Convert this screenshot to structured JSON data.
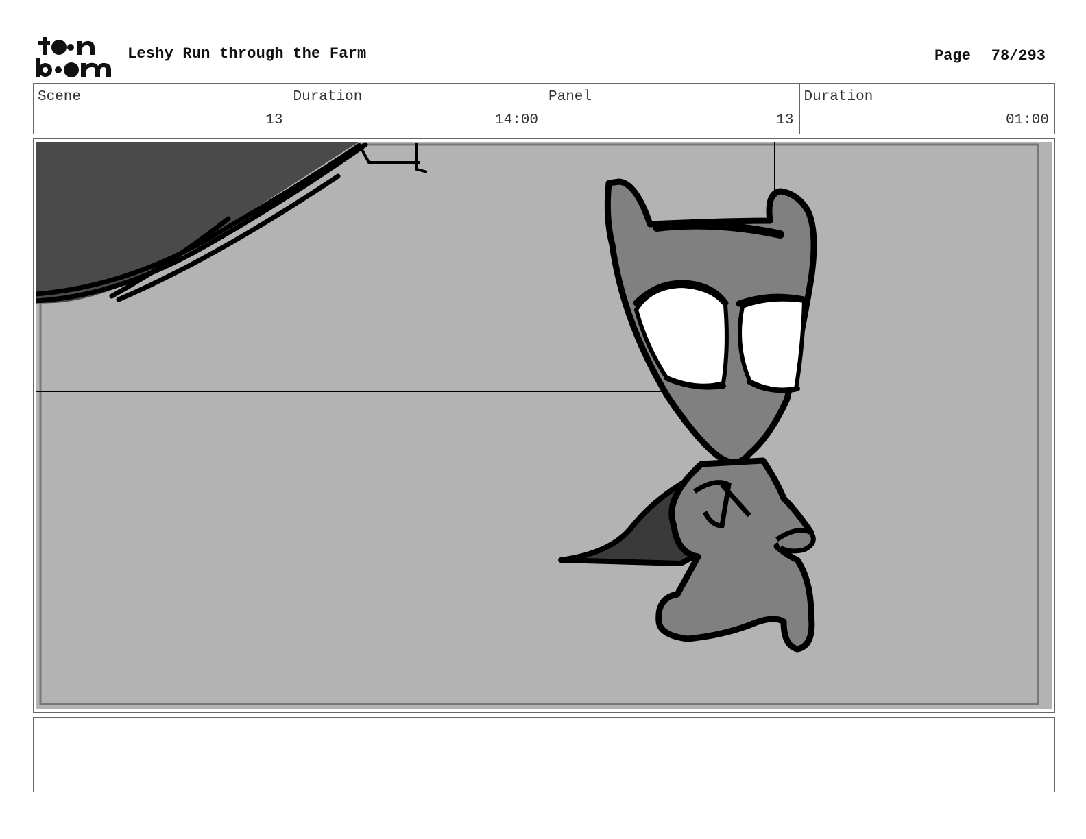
{
  "header": {
    "logo": "toon boom",
    "title": "Leshy Run through the Farm",
    "page_label": "Page",
    "page_value": "78/293"
  },
  "info": [
    {
      "label": "Scene",
      "value": "13"
    },
    {
      "label": "Duration",
      "value": "14:00"
    },
    {
      "label": "Panel",
      "value": "13"
    },
    {
      "label": "Duration",
      "value": "01:00"
    }
  ],
  "panel": {
    "background_color": "#b3b3b3",
    "shadow_color": "#4a4a4a",
    "character_color": "#808080",
    "cape_color": "#3a3a3a",
    "line_color": "#000000"
  },
  "notes": {
    "text": ""
  }
}
